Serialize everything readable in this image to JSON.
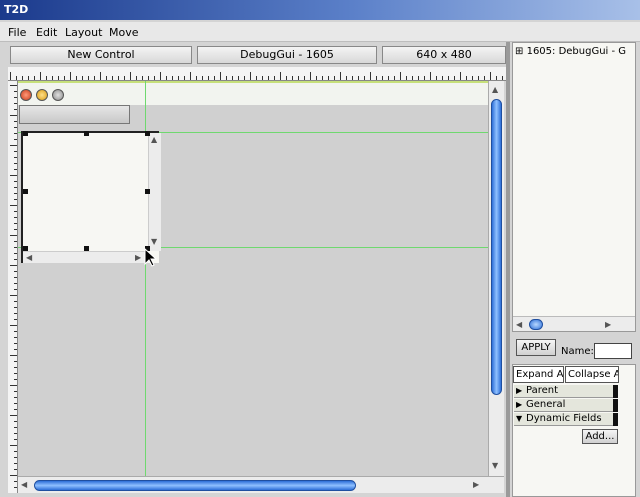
{
  "window": {
    "title": "T2D"
  },
  "menu": [
    "File",
    "Edit",
    "Layout",
    "Move"
  ],
  "infobar": {
    "new_control": "New Control",
    "gui_name": "DebugGui - 1605",
    "resolution": "640 x 480"
  },
  "tree": {
    "item": "1605: DebugGui - G",
    "expander": "⊞"
  },
  "apply": {
    "button": "APPLY",
    "name_label": "Name:",
    "name_value": ""
  },
  "inspector": {
    "expand_all": "Expand All",
    "collapse_all": "Collapse A",
    "groups": [
      {
        "label": "Parent",
        "expanded": false
      },
      {
        "label": "General",
        "expanded": false
      },
      {
        "label": "Dynamic Fields",
        "expanded": true
      }
    ],
    "add_button": "Add..."
  },
  "colors": {
    "guide": "#6fd86f",
    "scroll_thumb": "#2d6fd8",
    "titlebar": "#1b3a8c"
  }
}
